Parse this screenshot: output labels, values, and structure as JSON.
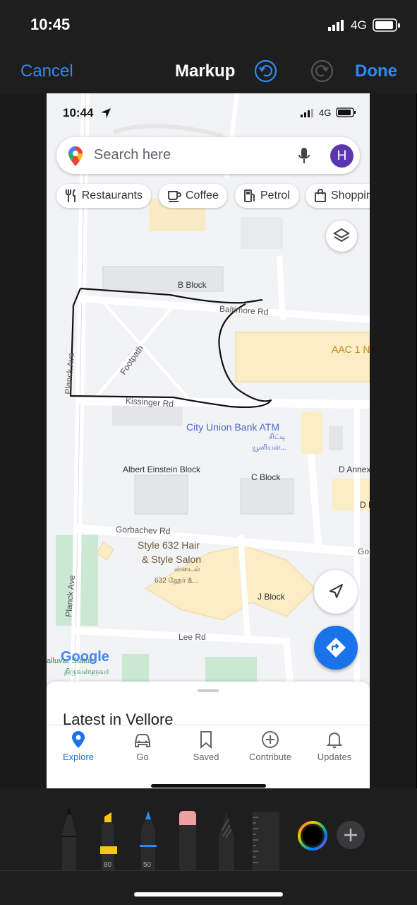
{
  "status": {
    "time": "10:45",
    "network": "4G"
  },
  "toolbar": {
    "cancel_label": "Cancel",
    "title": "Markup",
    "done_label": "Done"
  },
  "screenshot": {
    "status": {
      "time": "10:44",
      "network": "4G"
    },
    "search": {
      "placeholder": "Search here",
      "avatar_letter": "H"
    },
    "chips": [
      "Restaurants",
      "Coffee",
      "Petrol",
      "Shoppin"
    ],
    "map_labels": {
      "b_block": "B Block",
      "baltimore": "Baltimore Rd",
      "aac": "AAC 1 N",
      "footpath": "Footpath",
      "planck1": "Planck Ave",
      "kissinger": "Kissinger Rd",
      "atm": "City Union Bank ATM",
      "atm_tamil": "சிட்டி",
      "atm_tamil2": "யூனியன்...",
      "einstein": "Albert Einstein Block",
      "c_block": "C Block",
      "d_annex": "D Annex",
      "d_block": "D B",
      "gorbachev": "Gorbachev Rd",
      "go": "Go",
      "salon1": "Style 632 Hair",
      "salon2": "& Style Salon",
      "salon_tamil1": "ஸ்டைல்",
      "salon_tamil2": "632 ஹேர் &...",
      "planck2": "Planck Ave",
      "j_block": "J Block",
      "lee": "Lee Rd",
      "google": "Google",
      "valluvar": "alluvar Statue",
      "valluvar_tamil": "திருவள்ளுவர்"
    },
    "sheet_title": "Latest in Vellore",
    "nav": [
      {
        "label": "Explore",
        "icon": "explore-pin-icon"
      },
      {
        "label": "Go",
        "icon": "car-icon"
      },
      {
        "label": "Saved",
        "icon": "bookmark-icon"
      },
      {
        "label": "Contribute",
        "icon": "add-circle-icon"
      },
      {
        "label": "Updates",
        "icon": "bell-icon"
      }
    ]
  },
  "tools": {
    "marker_width": "80",
    "pen_width": "50"
  },
  "colors": {
    "accent": "#2f8af5",
    "maps_blue": "#1a73e8",
    "toolbar_bg": "#1e1e1e"
  }
}
